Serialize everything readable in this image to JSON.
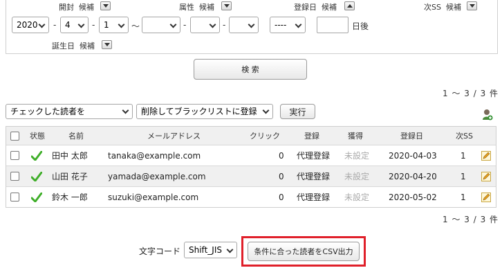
{
  "filters": {
    "open_label": "開封",
    "open_candidates": "候補",
    "attr_label": "属性",
    "attr_candidates": "候補",
    "regdate_label": "登録日",
    "regdate_candidates": "候補",
    "nextss_label": "次SS",
    "nextss_candidates": "候補",
    "birthday_label": "誕生日",
    "birthday_candidates": "候補",
    "from_year": "2020",
    "from_month": "4",
    "from_day": "1",
    "dash1": "-",
    "dash2": "-",
    "dash3": "-",
    "dash4": "-",
    "tilde": "〜",
    "to_year": "",
    "to_month": "",
    "to_day": "",
    "days_select": "----",
    "days_input": "",
    "days_after": "日後"
  },
  "search_button": "検 索",
  "result_count_top": "1 〜 3 / 3 件",
  "result_count_bottom": "1 〜 3 / 3 件",
  "bulk": {
    "target_select": "チェックした読者を",
    "action_select": "削除してブラックリストに登録",
    "run_button": "実行"
  },
  "table": {
    "headers": {
      "status": "状態",
      "name": "名前",
      "email": "メールアドレス",
      "click": "クリック",
      "register": "登録",
      "acquire": "獲得",
      "regdate": "登録日",
      "nextss": "次SS"
    },
    "rows": [
      {
        "name": "田中 太郎",
        "email": "tanaka@example.com",
        "click": "0",
        "register": "代理登録",
        "acquire": "未設定",
        "regdate": "2020-04-03",
        "nextss": "1"
      },
      {
        "name": "山田 花子",
        "email": "yamada@example.com",
        "click": "0",
        "register": "代理登録",
        "acquire": "未設定",
        "regdate": "2020-04-20",
        "nextss": "1"
      },
      {
        "name": "鈴木 一郎",
        "email": "suzuki@example.com",
        "click": "0",
        "register": "代理登録",
        "acquire": "未設定",
        "regdate": "2020-05-02",
        "nextss": "1"
      }
    ]
  },
  "export": {
    "encoding_label": "文字コード",
    "encoding_value": "Shift_JIS",
    "csv_button": "条件に合った読者をCSV出力"
  },
  "colors": {
    "highlight": "#e0202a",
    "check_green": "#3fae29",
    "row_alt": "#f0f0f0"
  },
  "icons": {
    "status": "check-icon",
    "edit": "edit-icon",
    "add_user": "add-user-icon"
  }
}
